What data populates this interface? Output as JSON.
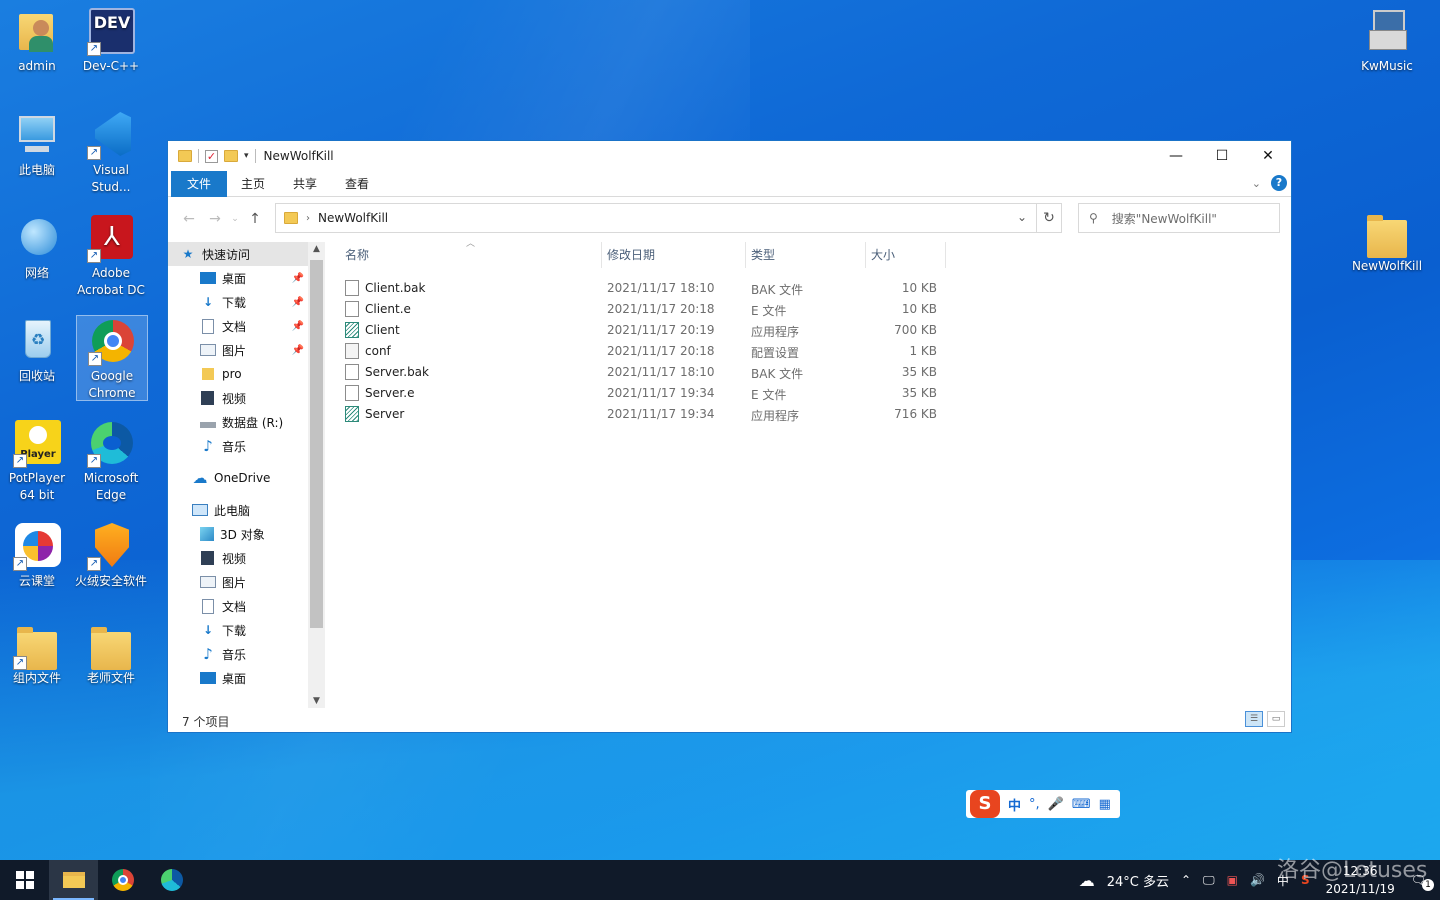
{
  "desktop": {
    "left_icons": [
      {
        "label": "admin"
      },
      {
        "label": "Dev-C++"
      },
      {
        "label": "此电脑"
      },
      {
        "label": "Visual Stud..."
      },
      {
        "label": "网络"
      },
      {
        "label": "Adobe Acrobat DC"
      },
      {
        "label": "回收站"
      },
      {
        "label": "Google Chrome"
      },
      {
        "label": "PotPlayer 64 bit"
      },
      {
        "label": "Microsoft Edge"
      },
      {
        "label": "云课堂"
      },
      {
        "label": "火绒安全软件"
      },
      {
        "label": "组内文件"
      },
      {
        "label": "老师文件"
      }
    ],
    "right_icons": [
      {
        "label": "KwMusic"
      },
      {
        "label": "NewWolfKill"
      }
    ],
    "dev_badge": "DEV",
    "potplayer_badge": "Player"
  },
  "explorer": {
    "title": "NewWolfKill",
    "ribbon_tabs": [
      "文件",
      "主页",
      "共享",
      "查看"
    ],
    "help": "?",
    "address": {
      "crumb": "NewWolfKill"
    },
    "search_placeholder": "搜索\"NewWolfKill\"",
    "nav": {
      "quick_access": "快速访问",
      "quick_items": [
        "桌面",
        "下载",
        "文档",
        "图片",
        "pro",
        "视频",
        "数据盘 (R:)",
        "音乐"
      ],
      "onedrive": "OneDrive",
      "this_pc": "此电脑",
      "pc_items": [
        "3D 对象",
        "视频",
        "图片",
        "文档",
        "下载",
        "音乐",
        "桌面"
      ]
    },
    "columns": [
      "名称",
      "修改日期",
      "类型",
      "大小"
    ],
    "files": [
      {
        "name": "Client.bak",
        "date": "2021/11/17 18:10",
        "type": "BAK 文件",
        "size": "10 KB",
        "icon": "file"
      },
      {
        "name": "Client.e",
        "date": "2021/11/17 20:18",
        "type": "E 文件",
        "size": "10 KB",
        "icon": "file"
      },
      {
        "name": "Client",
        "date": "2021/11/17 20:19",
        "type": "应用程序",
        "size": "700 KB",
        "icon": "app"
      },
      {
        "name": "conf",
        "date": "2021/11/17 20:18",
        "type": "配置设置",
        "size": "1 KB",
        "icon": "cfg"
      },
      {
        "name": "Server.bak",
        "date": "2021/11/17 18:10",
        "type": "BAK 文件",
        "size": "35 KB",
        "icon": "file"
      },
      {
        "name": "Server.e",
        "date": "2021/11/17 19:34",
        "type": "E 文件",
        "size": "35 KB",
        "icon": "file"
      },
      {
        "name": "Server",
        "date": "2021/11/17 19:34",
        "type": "应用程序",
        "size": "716 KB",
        "icon": "app"
      }
    ],
    "status": "7 个项目"
  },
  "ime": {
    "logo": "S",
    "mode": "中",
    "punct": "°,"
  },
  "taskbar": {
    "weather": "24°C 多云",
    "ime_indicator": "中",
    "time": "12:36",
    "date": "2021/11/19",
    "notifications": "1"
  },
  "watermark": "洛谷@Lotuses",
  "colors": {
    "accent": "#1979ca",
    "taskbar": "#101a29"
  }
}
